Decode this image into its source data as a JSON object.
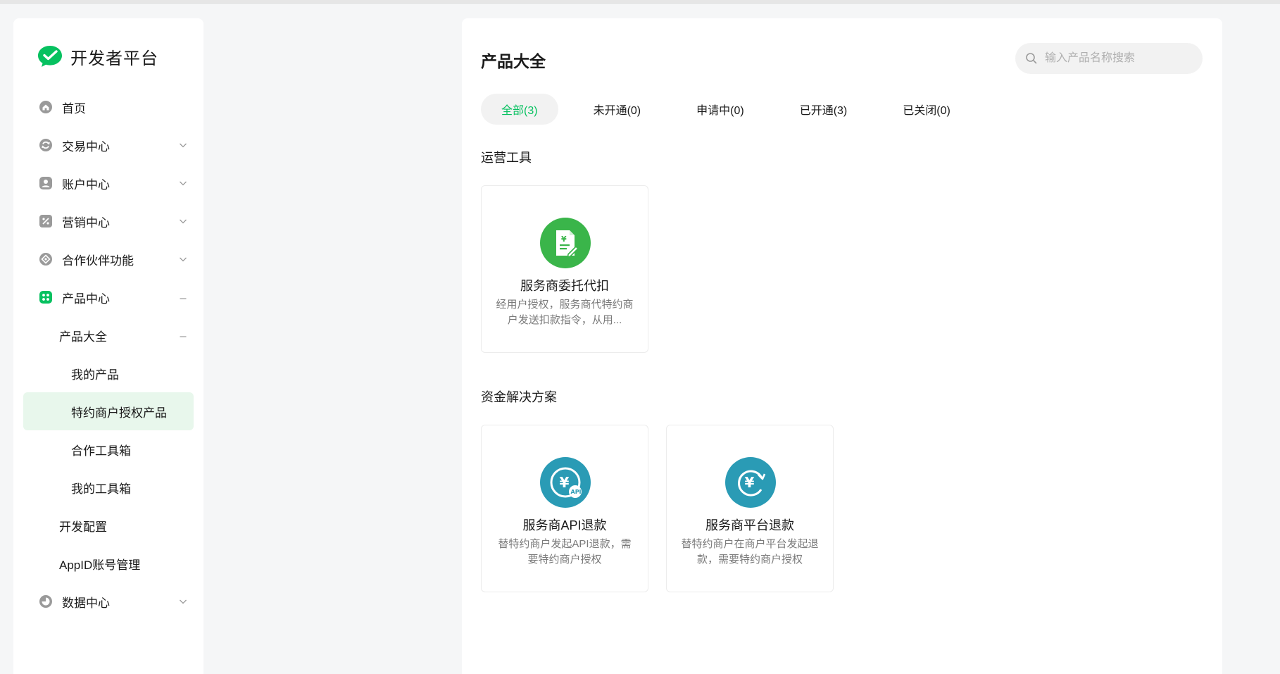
{
  "brand": {
    "title": "开发者平台",
    "logo_icon": "wechat-logo-icon",
    "logo_color": "#07c160"
  },
  "sidebar": {
    "items": [
      {
        "label": "首页",
        "icon": "home-icon",
        "expandable": false
      },
      {
        "label": "交易中心",
        "icon": "transaction-icon",
        "expandable": true,
        "expanded": false
      },
      {
        "label": "账户中心",
        "icon": "account-icon",
        "expandable": true,
        "expanded": false
      },
      {
        "label": "营销中心",
        "icon": "marketing-icon",
        "expandable": true,
        "expanded": false
      },
      {
        "label": "合作伙伴功能",
        "icon": "partner-icon",
        "expandable": true,
        "expanded": false
      },
      {
        "label": "产品中心",
        "icon": "product-center-icon",
        "expandable": true,
        "expanded": true
      },
      {
        "label": "产品大全",
        "level": 2,
        "expandable": true,
        "expanded": true
      },
      {
        "label": "我的产品",
        "level": 3
      },
      {
        "label": "特约商户授权产品",
        "level": 3,
        "active": true
      },
      {
        "label": "合作工具箱",
        "level": 3
      },
      {
        "label": "我的工具箱",
        "level": 3
      },
      {
        "label": "开发配置",
        "level": 2
      },
      {
        "label": "AppID账号管理",
        "level": 2
      },
      {
        "label": "数据中心",
        "icon": "data-center-icon",
        "expandable": true,
        "expanded": false
      }
    ]
  },
  "main": {
    "title": "产品大全",
    "search": {
      "placeholder": "输入产品名称搜索",
      "value": ""
    },
    "tabs": [
      {
        "label": "全部(3)",
        "active": true
      },
      {
        "label": "未开通(0)",
        "active": false
      },
      {
        "label": "申请中(0)",
        "active": false
      },
      {
        "label": "已开通(3)",
        "active": false
      },
      {
        "label": "已关闭(0)",
        "active": false
      }
    ],
    "sections": [
      {
        "title": "运营工具",
        "cards": [
          {
            "name": "服务商委托代扣",
            "desc": "经用户授权，服务商代特约商户发送扣款指令，从用...",
            "icon": "document-yuan-icon",
            "icon_color": "#3ab54a"
          }
        ]
      },
      {
        "title": "资金解决方案",
        "cards": [
          {
            "name": "服务商API退款",
            "desc": "替特约商户发起API退款，需要特约商户授权",
            "icon": "api-refund-icon",
            "icon_color": "#2a9bb5"
          },
          {
            "name": "服务商平台退款",
            "desc": "替特约商户在商户平台发起退款，需要特约商户授权",
            "icon": "platform-refund-icon",
            "icon_color": "#2a9bb5"
          }
        ]
      }
    ]
  },
  "colors": {
    "accent": "#07c160",
    "active_bg": "#e8f7ec",
    "page_bg": "#f5f6f7"
  }
}
